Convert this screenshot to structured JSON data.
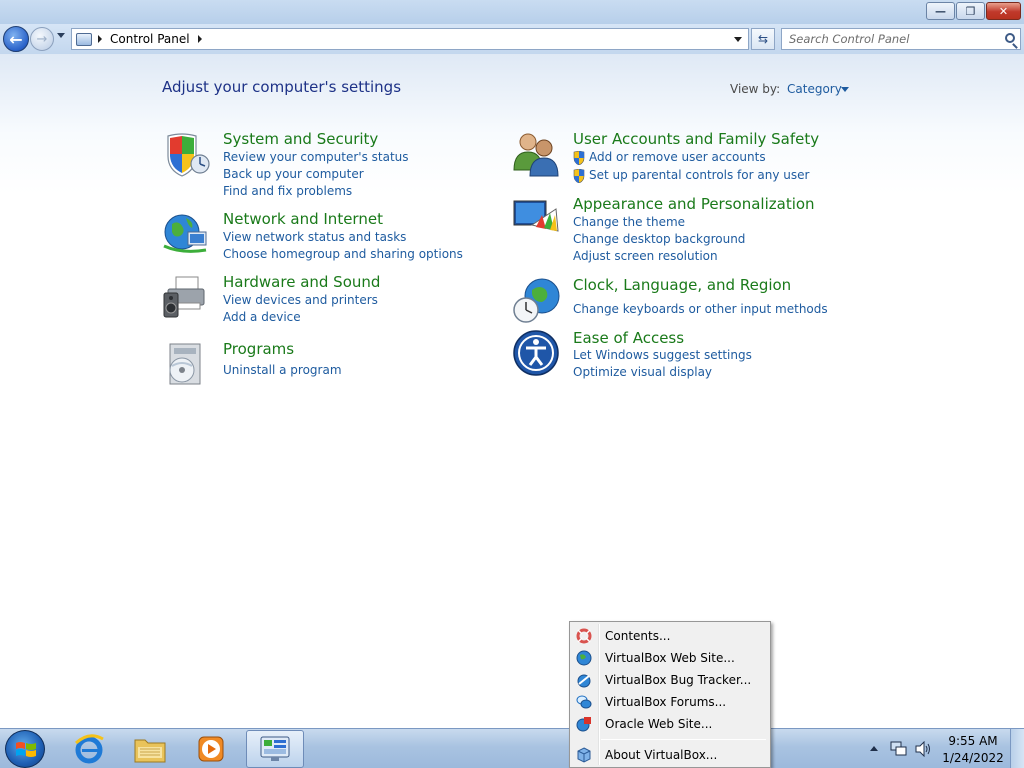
{
  "window": {
    "minimize_glyph": "—",
    "maximize_glyph": "❐",
    "close_glyph": "✕"
  },
  "navbar": {
    "breadcrumb": "Control Panel",
    "search_placeholder": "Search Control Panel"
  },
  "header": {
    "title": "Adjust your computer's settings",
    "view_by_label": "View by:",
    "view_by_value": "Category"
  },
  "categories": [
    {
      "title": "System and Security",
      "icon": "shield-icon",
      "links": [
        "Review your computer's status",
        "Back up your computer",
        "Find and fix problems"
      ]
    },
    {
      "title": "Network and Internet",
      "icon": "network-globe-icon",
      "links": [
        "View network status and tasks",
        "Choose homegroup and sharing options"
      ]
    },
    {
      "title": "Hardware and Sound",
      "icon": "printer-speaker-icon",
      "links": [
        "View devices and printers",
        "Add a device"
      ]
    },
    {
      "title": "Programs",
      "icon": "programs-disc-icon",
      "links": [
        "Uninstall a program"
      ]
    },
    {
      "title": "User Accounts and Family Safety",
      "icon": "users-icon",
      "links": [
        "Add or remove user accounts",
        "Set up parental controls for any user"
      ]
    },
    {
      "title": "Appearance and Personalization",
      "icon": "monitor-palette-icon",
      "links": [
        "Change the theme",
        "Change desktop background",
        "Adjust screen resolution"
      ]
    },
    {
      "title": "Clock, Language, and Region",
      "icon": "clock-globe-icon",
      "links": [
        "Change keyboards or other input methods"
      ]
    },
    {
      "title": "Ease of Access",
      "icon": "ease-of-access-icon",
      "links": [
        "Let Windows suggest settings",
        "Optimize visual display"
      ]
    }
  ],
  "context_menu": {
    "items": [
      {
        "label": "Contents...",
        "icon": "help-contents-icon"
      },
      {
        "label": "VirtualBox Web Site...",
        "icon": "globe-icon"
      },
      {
        "label": "VirtualBox Bug Tracker...",
        "icon": "bug-tracker-icon"
      },
      {
        "label": "VirtualBox Forums...",
        "icon": "forums-icon"
      },
      {
        "label": "Oracle Web Site...",
        "icon": "oracle-icon"
      },
      {
        "label": "About VirtualBox...",
        "icon": "virtualbox-icon"
      }
    ]
  },
  "taskbar": {
    "pinned": [
      "internet-explorer-icon",
      "explorer-folder-icon",
      "media-player-icon",
      "control-panel-icon"
    ],
    "clock_time": "9:55 AM",
    "clock_date": "1/24/2022"
  },
  "colors": {
    "category_title": "#1a7a1a",
    "link": "#1e5b9f",
    "heading": "#1e3287"
  }
}
